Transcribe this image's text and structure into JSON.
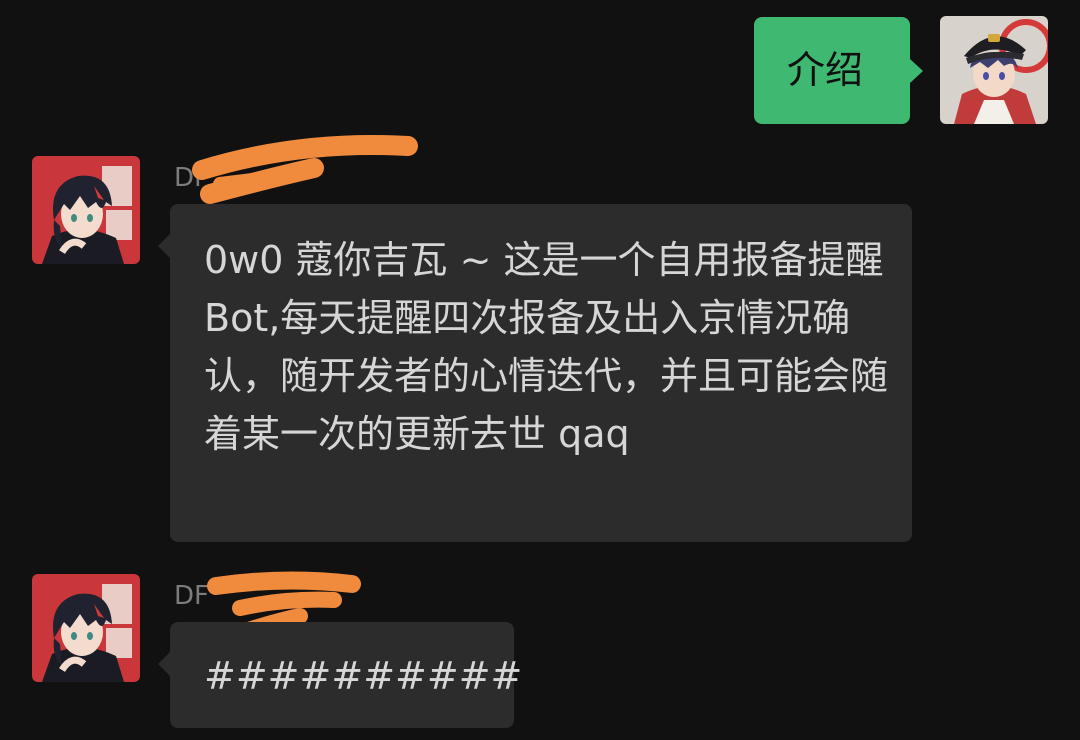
{
  "messages": [
    {
      "direction": "outgoing",
      "text": "介绍"
    },
    {
      "direction": "incoming",
      "sender": "DF",
      "text": "0w0 蔻你吉瓦 ~ 这是一个自用报备提醒 Bot,每天提醒四次报备及出入京情况确认，随开发者的心情迭代，并且可能会随着某一次的更新去世 qaq"
    },
    {
      "direction": "incoming",
      "sender": "DF",
      "text": "##########"
    }
  ],
  "colors": {
    "background": "#111111",
    "incoming_bubble": "#2c2c2c",
    "outgoing_bubble": "#3fb871",
    "sender_name": "#7c7c7c",
    "redaction": "#f08a3c"
  },
  "icons": {
    "self_avatar": "user-avatar-icon",
    "bot_avatar": "bot-avatar-icon"
  }
}
